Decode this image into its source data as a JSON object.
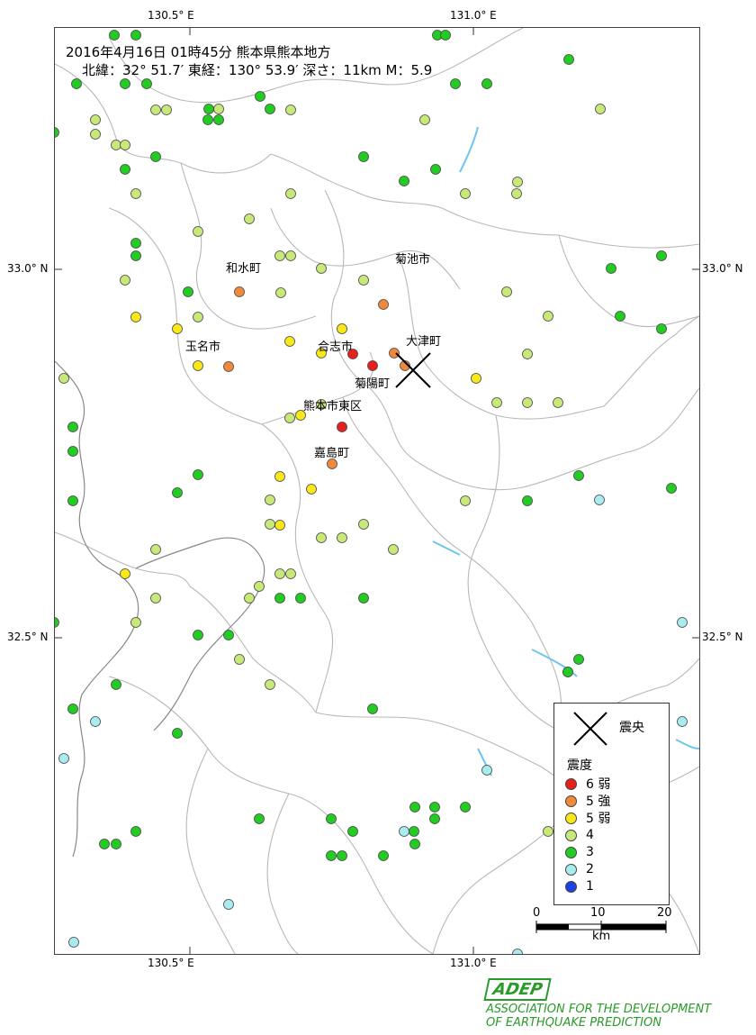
{
  "header": {
    "line1": "2016年4月16日 01時45分  熊本県熊本地方",
    "line2": "北緯：32° 51.7′ 東経：130° 53.9′ 深さ：11km  M：5.9"
  },
  "coords": {
    "top_left": "130.5° E",
    "top_right": "131.0° E",
    "bottom_left": "130.5° E",
    "bottom_right": "131.0° E",
    "left_upper": "33.0° N",
    "left_lower": "32.5° N",
    "right_upper": "33.0° N",
    "right_lower": "32.5° N"
  },
  "places": [
    {
      "name": "和水町"
    },
    {
      "name": "菊池市"
    },
    {
      "name": "玉名市"
    },
    {
      "name": "合志市"
    },
    {
      "name": "大津町"
    },
    {
      "name": "菊陽町"
    },
    {
      "name": "熊本市東区"
    },
    {
      "name": "嘉島町"
    }
  ],
  "colors": {
    "6弱": "#e8201c",
    "5強": "#f08a3a",
    "5弱": "#f8e81a",
    "4": "#c8e87a",
    "3": "#22cc22",
    "2": "#a8ecf0",
    "1": "#2040e0",
    "border": "#b8b8b8",
    "water": "#6ec6ec"
  },
  "legend": {
    "epicenter_label": "震央",
    "intensity_title": "震度",
    "items": [
      {
        "label": "6 弱",
        "key": "6弱"
      },
      {
        "label": "5 強",
        "key": "5強"
      },
      {
        "label": "5 弱",
        "key": "5弱"
      },
      {
        "label": "4",
        "key": "4"
      },
      {
        "label": "3",
        "key": "3"
      },
      {
        "label": "2",
        "key": "2"
      },
      {
        "label": "1",
        "key": "1"
      }
    ]
  },
  "scale": {
    "labels": [
      "0",
      "10",
      "20"
    ],
    "unit": "km"
  },
  "logo": {
    "mark": "ADEP",
    "line1": "ASSOCIATION  FOR THE DEVELOPMENT",
    "line2": "OF EARTHQUAKE PREDICTION"
  }
}
